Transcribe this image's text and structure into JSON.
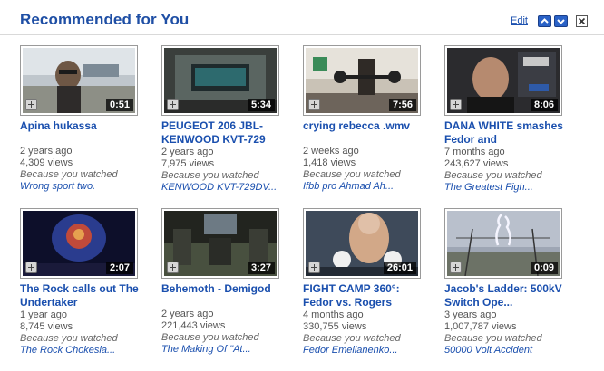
{
  "header": {
    "title": "Recommended for You",
    "edit_label": "Edit",
    "colors": {
      "accent": "#1f4fa5",
      "link": "#1a4fae"
    }
  },
  "because_label": "Because you watched",
  "videos": [
    {
      "title": "Apina hukassa",
      "duration": "0:51",
      "age": "2 years ago",
      "views": "4,309 views",
      "source": "Wrong sport two."
    },
    {
      "title": "PEUGEOT 206 JBL-KENWOOD KVT-729",
      "duration": "5:34",
      "age": "2 years ago",
      "views": "7,975 views",
      "source": "KENWOOD KVT-729DV..."
    },
    {
      "title": "crying rebecca .wmv",
      "duration": "7:56",
      "age": "2 weeks ago",
      "views": "1,418 views",
      "source": "Ifbb pro Ahmad Ah..."
    },
    {
      "title": "DANA WHITE smashes Fedor and",
      "duration": "8:06",
      "age": "7 months ago",
      "views": "243,627 views",
      "source": "The Greatest Figh..."
    },
    {
      "title": "The Rock calls out The Undertaker",
      "duration": "2:07",
      "age": "1 year ago",
      "views": "8,745 views",
      "source": "The Rock Chokesla..."
    },
    {
      "title": "Behemoth - Demigod",
      "duration": "3:27",
      "age": "2 years ago",
      "views": "221,443 views",
      "source": "The Making Of \"At..."
    },
    {
      "title": "FIGHT CAMP 360°: Fedor vs. Rogers",
      "duration": "26:01",
      "age": "4 months ago",
      "views": "330,755 views",
      "source": "Fedor Emelianenko..."
    },
    {
      "title": "Jacob's Ladder: 500kV Switch Ope...",
      "duration": "0:09",
      "age": "3 years ago",
      "views": "1,007,787 views",
      "source": "50000 Volt Accident"
    }
  ]
}
